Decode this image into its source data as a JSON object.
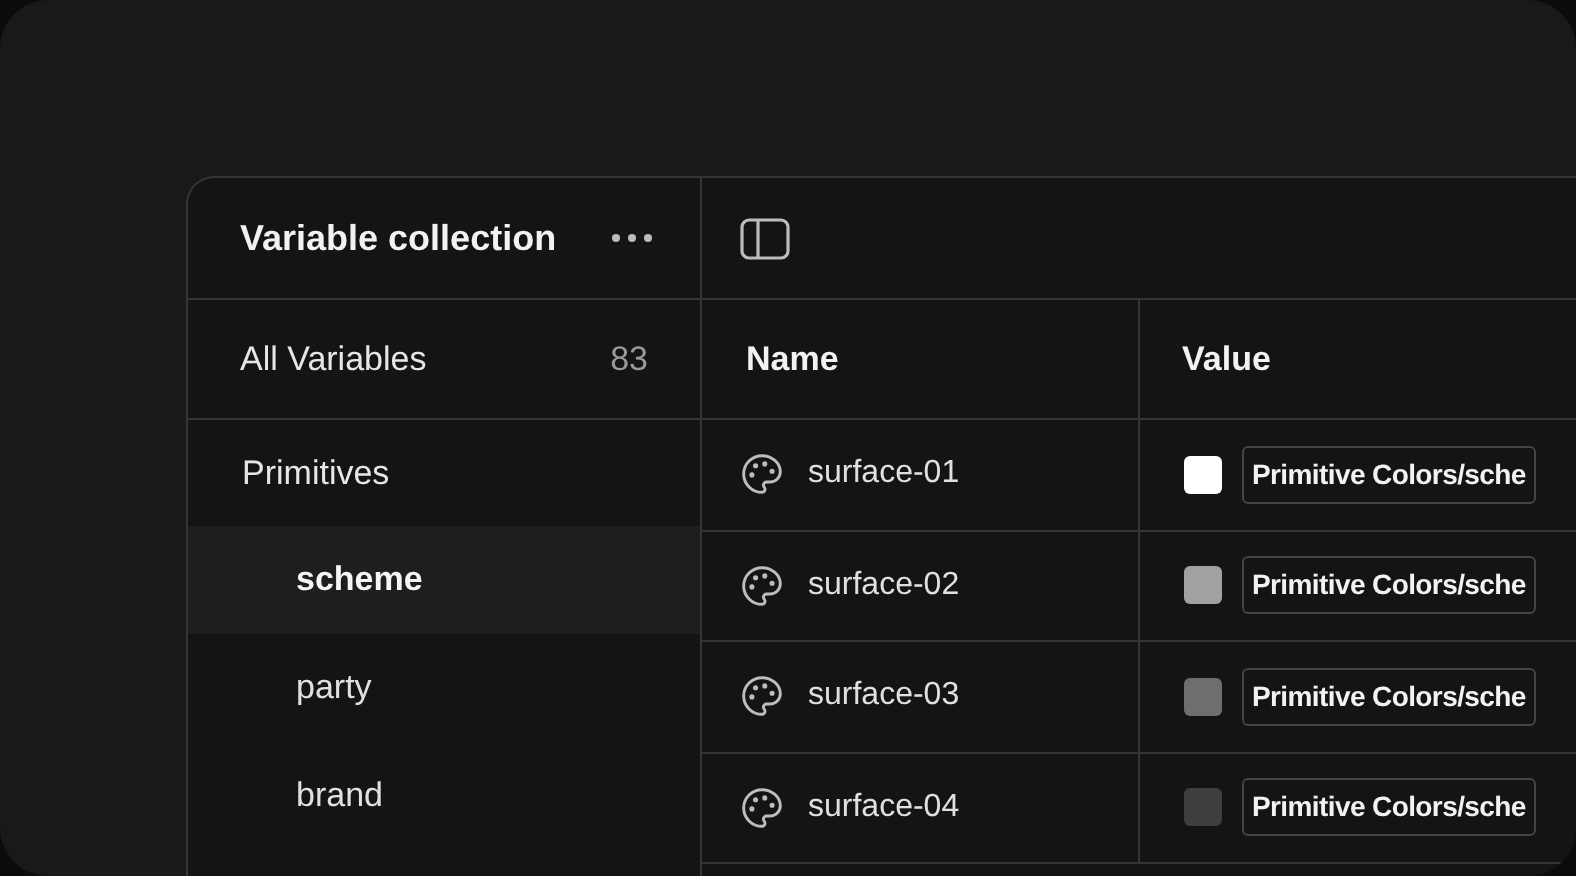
{
  "sidebar": {
    "title": "Variable collection",
    "all_variables": {
      "label": "All Variables",
      "count": "83"
    },
    "groups": [
      {
        "label": "Primitives",
        "children": [
          {
            "label": "scheme",
            "selected": true
          },
          {
            "label": "party",
            "selected": false
          },
          {
            "label": "brand",
            "selected": false
          }
        ]
      }
    ]
  },
  "table": {
    "columns": [
      "Name",
      "Value"
    ],
    "rows": [
      {
        "name": "surface-01",
        "color": "#ffffff",
        "value": "Primitive Colors/sche"
      },
      {
        "name": "surface-02",
        "color": "#a1a1a1",
        "value": "Primitive Colors/sche"
      },
      {
        "name": "surface-03",
        "color": "#6e6e6e",
        "value": "Primitive Colors/sche"
      },
      {
        "name": "surface-04",
        "color": "#3e3e3e",
        "value": "Primitive Colors/sche"
      }
    ]
  }
}
